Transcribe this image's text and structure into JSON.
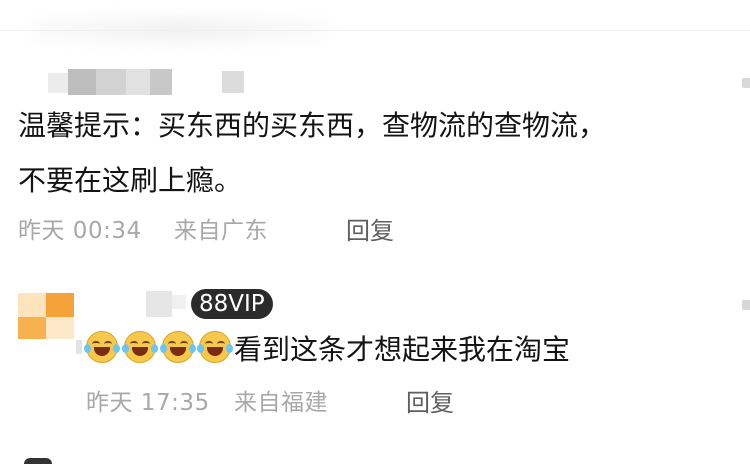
{
  "comment1": {
    "text_line1": "温馨提示：买东西的买东西，查物流的查物流，",
    "text_line2": "不要在这刷上瘾。",
    "time": "昨天 00:34",
    "location": "来自广东",
    "reply_label": "回复"
  },
  "comment2": {
    "badge": "88VIP",
    "emoji_names": [
      "tears-of-joy-icon",
      "tears-of-joy-icon",
      "tears-of-joy-icon",
      "tears-of-joy-icon"
    ],
    "text": "看到这条才想起来我在淘宝",
    "time": "昨天 17:35",
    "location": "来自福建",
    "reply_label": "回复"
  },
  "colors": {
    "meta": "#a8a8a8",
    "badge_bg": "#2b2b2b",
    "avatar_orange": "#f5a23a"
  }
}
